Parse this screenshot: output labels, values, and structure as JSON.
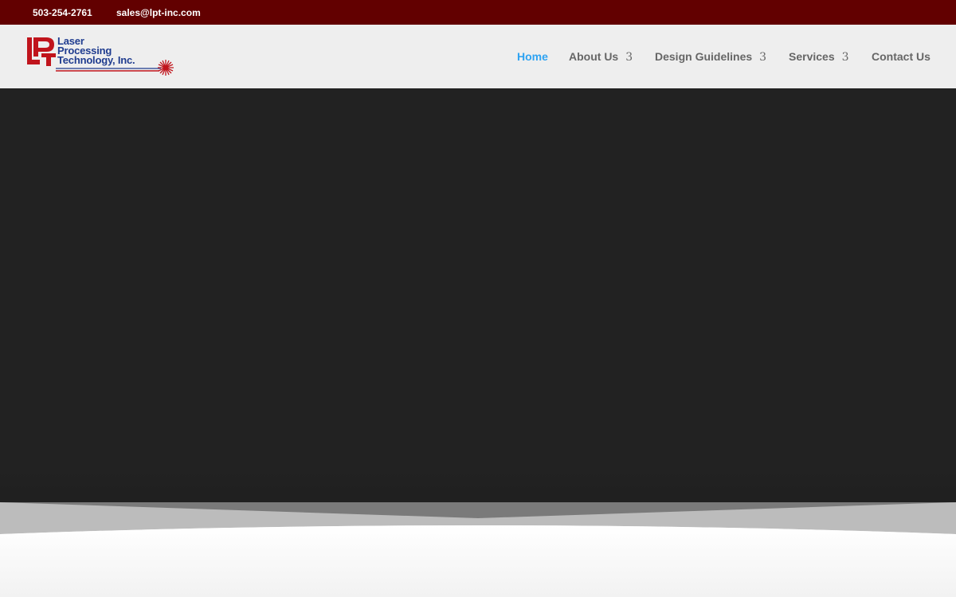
{
  "topbar": {
    "phone": "503-254-2761",
    "email": "sales@lpt-inc.com"
  },
  "logo": {
    "line1": "Laser",
    "line2": "Processing",
    "line3": "Technology, Inc."
  },
  "nav": {
    "items": [
      {
        "label": "Home",
        "active": true
      },
      {
        "label": "About Us",
        "dropdown_icon": "chevron-down-icon"
      },
      {
        "label": "Design Guidelines",
        "dropdown_icon": "chevron-down-icon"
      },
      {
        "label": "Services",
        "dropdown_icon": "chevron-down-icon"
      },
      {
        "label": "Contact Us"
      }
    ]
  },
  "colors": {
    "topbar": "#620000",
    "header": "#eeeeee",
    "hero": "#222222",
    "nav_active": "#2ea3f2",
    "nav_text": "#666666",
    "logo_red": "#c0141c",
    "logo_blue": "#1f3c8f"
  }
}
